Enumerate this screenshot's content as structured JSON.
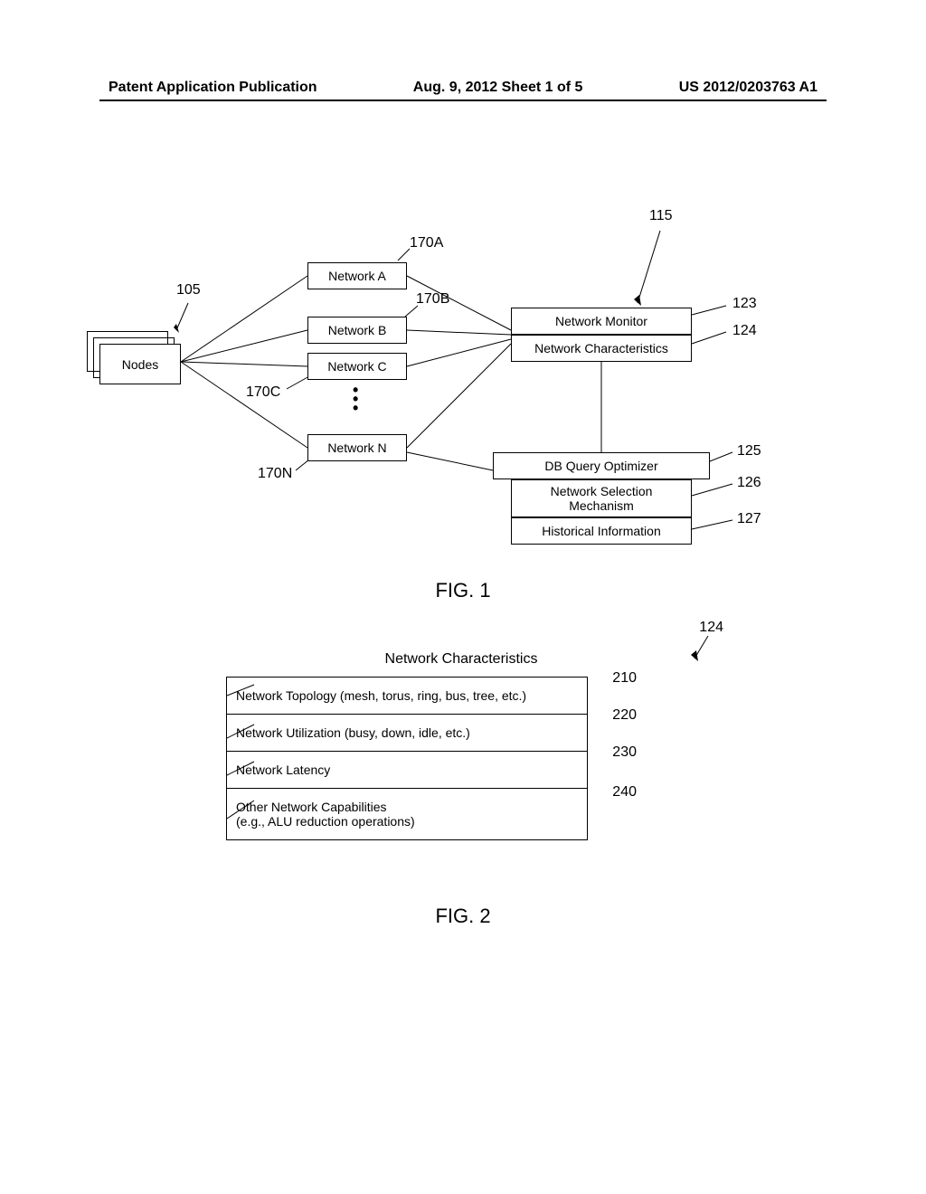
{
  "header": {
    "left": "Patent Application Publication",
    "center": "Aug. 9, 2012  Sheet 1 of 5",
    "right": "US 2012/0203763 A1"
  },
  "fig1": {
    "title": "FIG. 1",
    "nodes": "Nodes",
    "network_a": "Network A",
    "network_b": "Network B",
    "network_c": "Network C",
    "network_n": "Network N",
    "monitor": "Network Monitor",
    "characteristics": "Network Characteristics",
    "optimizer": "DB Query Optimizer",
    "selection": "Network Selection Mechanism",
    "historical": "Historical Information",
    "labels": {
      "l105": "105",
      "l115": "115",
      "l123": "123",
      "l124": "124",
      "l125": "125",
      "l126": "126",
      "l127": "127",
      "l170a": "170A",
      "l170b": "170B",
      "l170c": "170C",
      "l170n": "170N"
    }
  },
  "fig2": {
    "title": "FIG. 2",
    "heading": "Network Characteristics",
    "label_124": "124",
    "rows": [
      {
        "text": "Network Topology (mesh, torus, ring, bus, tree, etc.)",
        "label": "210"
      },
      {
        "text": "Network Utilization (busy, down, idle, etc.)",
        "label": "220"
      },
      {
        "text": "Network Latency",
        "label": "230"
      },
      {
        "text_line1": "Other Network Capabilities",
        "text_line2": "(e.g., ALU reduction operations)",
        "label": "240"
      }
    ]
  }
}
